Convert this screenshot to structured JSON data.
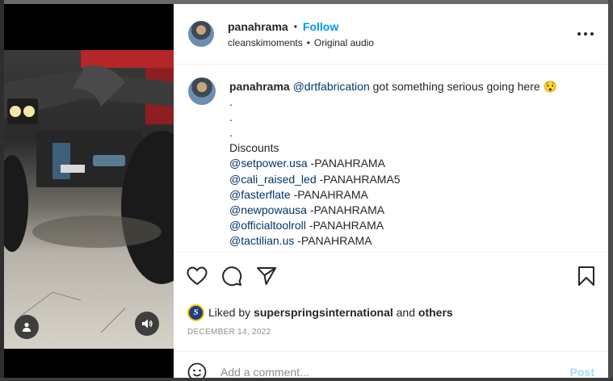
{
  "header": {
    "username": "panahrama",
    "separator": "•",
    "follow_label": "Follow",
    "audio_author": "cleanskimoments",
    "audio_separator": "•",
    "audio_label": "Original audio",
    "more_icon": "more-horizontal-icon"
  },
  "media": {
    "user_tag_icon": "user-icon",
    "mute_icon": "speaker-icon"
  },
  "caption": {
    "username": "panahrama",
    "mention": "@drtfabrication",
    "text": " got something serious going here 😯",
    "dot_lines": [
      ".",
      ".",
      "."
    ],
    "discounts_heading": "Discounts",
    "discount_lines": [
      {
        "mention": "@setpower.usa",
        "code": " -PANAHRAMA"
      },
      {
        "mention": "@cali_raised_led",
        "code": " -PANAHRAMA5"
      },
      {
        "mention": "@fasterflate",
        "code": " -PANAHRAMA"
      },
      {
        "mention": "@newpowausa",
        "code": " -PANAHRAMA"
      },
      {
        "mention": "@officialtoolroll",
        "code": " -PANAHRAMA"
      },
      {
        "mention": "@tactilian.us",
        "code": " -PANAHRAMA"
      }
    ]
  },
  "actions": {
    "like_icon": "heart-icon",
    "comment_icon": "comment-icon",
    "share_icon": "paper-plane-icon",
    "save_icon": "bookmark-icon"
  },
  "likes": {
    "avatar_letter": "S",
    "prefix": "Liked by",
    "user": "superspringsinternational",
    "conjunction": "and",
    "others": "others"
  },
  "date": "DECEMBER 14, 2022",
  "comment": {
    "placeholder": "Add a comment...",
    "post_label": "Post",
    "emoji_icon": "smiley-icon"
  },
  "colors": {
    "accent": "#0095f6",
    "mention": "#00376b",
    "muted": "#8e8e8e",
    "text": "#262626"
  }
}
